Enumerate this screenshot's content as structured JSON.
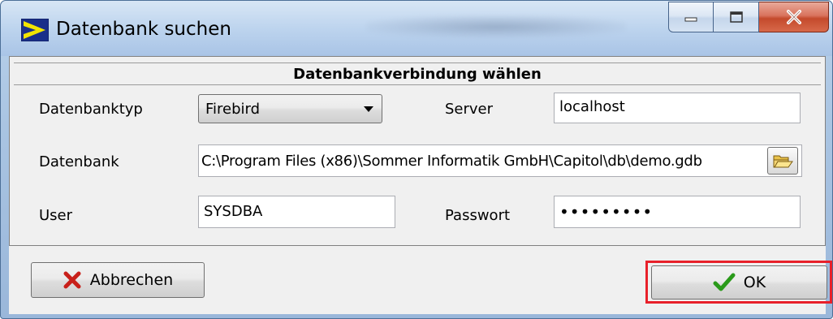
{
  "window": {
    "title": "Datenbank suchen",
    "background_title_blurred": "Log: Gelöschte Datensätze"
  },
  "icons": {
    "app": "capitol-app-icon",
    "minimize": "minimize-icon",
    "maximize": "maximize-icon",
    "close": "close-icon",
    "folder": "folder-open-icon",
    "cancel": "red-x-icon",
    "ok": "green-check-icon"
  },
  "form": {
    "header": "Datenbankverbindung wählen",
    "db_type": {
      "label": "Datenbanktyp",
      "value": "Firebird"
    },
    "server": {
      "label": "Server",
      "value": "localhost"
    },
    "database": {
      "label": "Datenbank",
      "value": "C:\\Program Files (x86)\\Sommer Informatik GmbH\\Capitol\\db\\demo.gdb"
    },
    "user": {
      "label": "User",
      "value": "SYSDBA"
    },
    "password": {
      "label": "Passwort",
      "value": "•••••••••"
    }
  },
  "buttons": {
    "cancel": "Abbrechen",
    "ok": "OK"
  },
  "colors": {
    "highlight": "#e8202a",
    "check": "#2a9a1a",
    "cross": "#c8201a"
  }
}
